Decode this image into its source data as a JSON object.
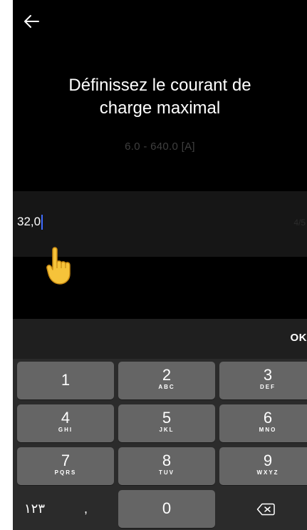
{
  "header": {
    "back_icon": "arrow-left-icon"
  },
  "title": {
    "line1": "Définissez le courant de",
    "line2": "charge maximal"
  },
  "range": "6.0 - 640.0 [A]",
  "input": {
    "value": "32,0",
    "counter": "4/5"
  },
  "pointer_icon": "pointing-hand-icon",
  "ok_label": "OK",
  "keypad": {
    "keys": [
      {
        "num": "1",
        "sub": ""
      },
      {
        "num": "2",
        "sub": "ABC"
      },
      {
        "num": "3",
        "sub": "DEF"
      },
      {
        "num": "4",
        "sub": "GHI"
      },
      {
        "num": "5",
        "sub": "JKL"
      },
      {
        "num": "6",
        "sub": "MNO"
      },
      {
        "num": "7",
        "sub": "PQRS"
      },
      {
        "num": "8",
        "sub": "TUV"
      },
      {
        "num": "9",
        "sub": "WXYZ"
      },
      {
        "num": "0",
        "sub": ""
      }
    ],
    "arabic_label": "١٢٣",
    "comma_label": ",",
    "delete_icon": "backspace-icon"
  },
  "colors": {
    "background": "#000000",
    "key": "#656565",
    "keypad_background": "#2b2b2b",
    "caret": "#3f6bff"
  }
}
